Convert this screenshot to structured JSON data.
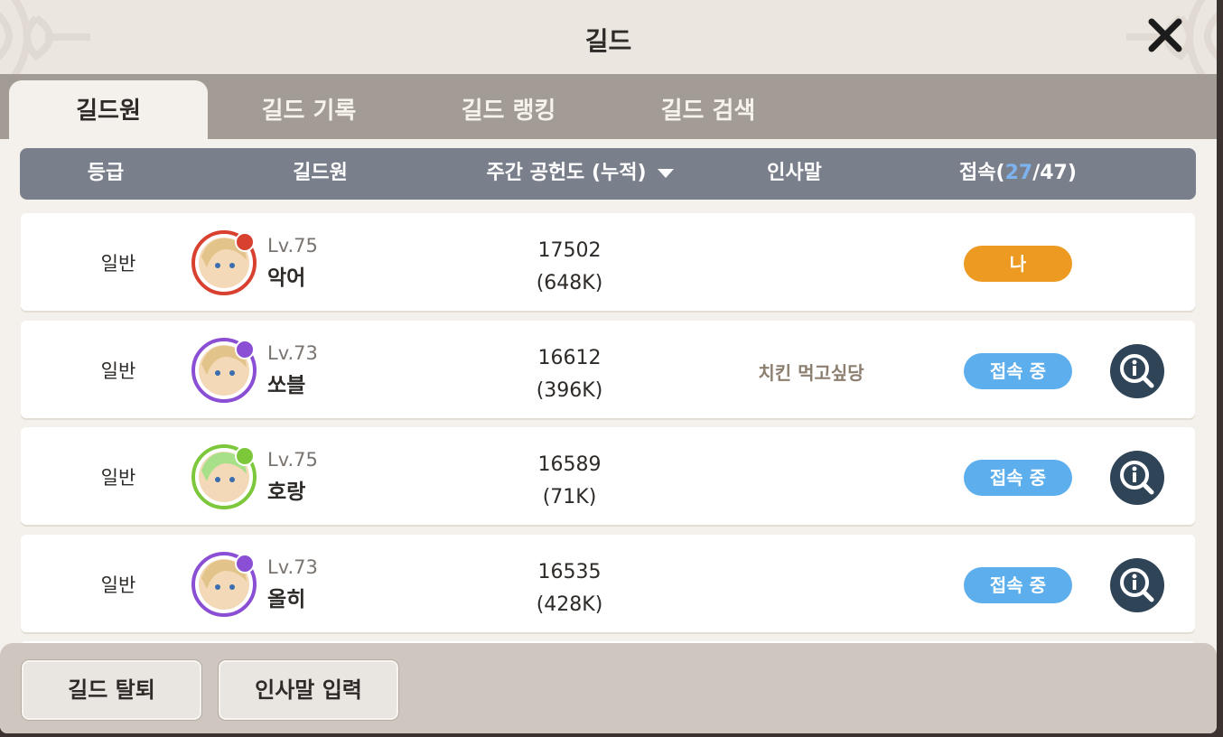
{
  "window": {
    "title": "길드"
  },
  "tabs": [
    {
      "label": "길드원",
      "active": true
    },
    {
      "label": "길드 기록",
      "active": false
    },
    {
      "label": "길드 랭킹",
      "active": false
    },
    {
      "label": "길드 검색",
      "active": false
    }
  ],
  "table": {
    "headers": {
      "grade": "등급",
      "member": "길드원",
      "contribution": "주간 공헌도 (누적)",
      "greeting": "인사말",
      "online_label": "접속(",
      "online_count": "27",
      "online_total": "/47)"
    },
    "rows": [
      {
        "grade": "일반",
        "level": "Lv.75",
        "name": "악어",
        "weekly": "17502",
        "total": "(648K)",
        "greeting": "",
        "status": "나",
        "status_type": "me",
        "element_color": "#d8402f"
      },
      {
        "grade": "일반",
        "level": "Lv.73",
        "name": "쏘블",
        "weekly": "16612",
        "total": "(396K)",
        "greeting": "치킨 먹고싶당",
        "status": "접속 중",
        "status_type": "online",
        "element_color": "#8a4fd4"
      },
      {
        "grade": "일반",
        "level": "Lv.75",
        "name": "호랑",
        "weekly": "16589",
        "total": "(71K)",
        "greeting": "",
        "status": "접속 중",
        "status_type": "online",
        "element_color": "#7cc83a"
      },
      {
        "grade": "일반",
        "level": "Lv.73",
        "name": "올히",
        "weekly": "16535",
        "total": "(428K)",
        "greeting": "",
        "status": "접속 중",
        "status_type": "online",
        "element_color": "#8a4fd4"
      }
    ]
  },
  "buttons": {
    "leave": "길드 탈퇴",
    "greeting_input": "인사말 입력"
  },
  "colors": {
    "me_badge": "#ec9a21",
    "online_badge": "#5daeed",
    "header_bg": "#7a7f8c",
    "info_button": "#2f4457"
  }
}
